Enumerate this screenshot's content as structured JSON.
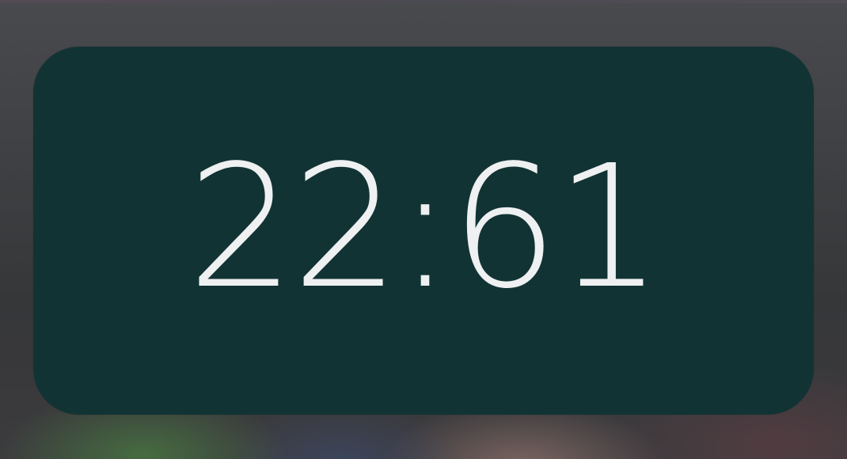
{
  "clock_widget": {
    "time": "22:61",
    "background_color": "#123334",
    "text_color": "#eef0f1"
  }
}
